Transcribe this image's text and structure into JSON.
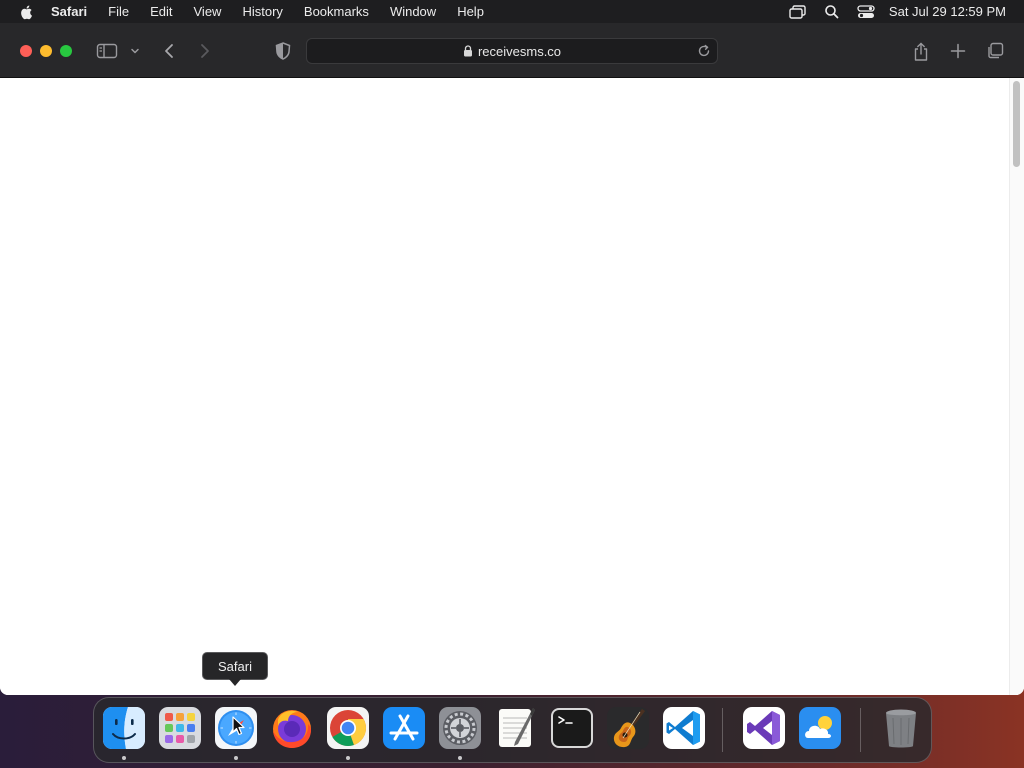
{
  "menubar": {
    "app_name": "Safari",
    "items": [
      "File",
      "Edit",
      "View",
      "History",
      "Bookmarks",
      "Window",
      "Help"
    ],
    "clock": "Sat Jul 29  12:59 PM"
  },
  "browser": {
    "url": "receivesms.co"
  },
  "tooltip": {
    "text": "Safari"
  },
  "dock": {
    "apps": [
      {
        "name": "Finder",
        "icon": "finder-icon",
        "running": true
      },
      {
        "name": "Launchpad",
        "icon": "launchpad-icon",
        "running": false
      },
      {
        "name": "Safari",
        "icon": "safari-icon",
        "running": true
      },
      {
        "name": "Firefox",
        "icon": "firefox-icon",
        "running": false
      },
      {
        "name": "Google Chrome",
        "icon": "chrome-icon",
        "running": true
      },
      {
        "name": "App Store",
        "icon": "app-store-icon",
        "running": false
      },
      {
        "name": "System Settings",
        "icon": "system-settings-icon",
        "running": true
      },
      {
        "name": "TextEdit",
        "icon": "textedit-icon",
        "running": false
      },
      {
        "name": "Terminal",
        "icon": "terminal-icon",
        "running": false
      },
      {
        "name": "GarageBand",
        "icon": "garageband-icon",
        "running": false
      },
      {
        "name": "Visual Studio Code",
        "icon": "vscode-icon",
        "running": false
      },
      {
        "name": "Visual Studio",
        "icon": "visual-studio-icon",
        "running": false
      },
      {
        "name": "Weather",
        "icon": "weather-icon",
        "running": false
      },
      {
        "name": "Trash",
        "icon": "trash-icon",
        "running": false
      }
    ]
  },
  "colors": {
    "close": "#fe5f57",
    "minimize": "#febc2e",
    "maximize": "#28c840"
  }
}
